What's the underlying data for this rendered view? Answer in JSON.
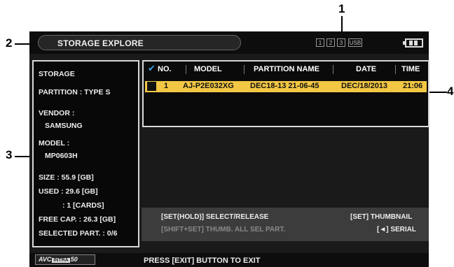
{
  "callouts": {
    "c1": "1",
    "c2": "2",
    "c3": "3",
    "c4": "4"
  },
  "header": {
    "title": "STORAGE EXPLORE",
    "slots": [
      "1",
      "2",
      "3",
      "USB"
    ],
    "battery_icon": "battery-icon"
  },
  "storage": {
    "heading": "STORAGE",
    "partition": "PARTITION : TYPE S",
    "vendor_label": "VENDOR :",
    "vendor_value": "SAMSUNG",
    "model_label": "MODEL :",
    "model_value": "MP0603H",
    "size": "SIZE : 55.9 [GB]",
    "used": "USED : 29.6 [GB]",
    "cards": ": 1 [CARDS]",
    "free": "FREE CAP. : 26.3 [GB]",
    "selected": "SELECTED PART. : 0/6"
  },
  "table": {
    "columns": [
      "NO.",
      "MODEL",
      "PARTITION NAME",
      "DATE",
      "TIME"
    ],
    "rows": [
      {
        "no": "1",
        "model": "AJ-P2E032XG",
        "partition_name": "DEC18-13 21-06-45",
        "date": "DEC/18/2013",
        "time": "21:06"
      }
    ]
  },
  "help": {
    "select": "[SET(HOLD)] SELECT/RELEASE",
    "thumbnail": "[SET] THUMBNAIL",
    "thumb_all": "[SHIFT+SET] THUMB. ALL SEL PART.",
    "serial": "[◄] SERIAL"
  },
  "footer": {
    "logo_avc": "AVC",
    "logo_intra": "INTRA",
    "logo_num": "50",
    "exit": "PRESS [EXIT] BUTTON TO EXIT"
  },
  "colors": {
    "highlight": "#f2c744",
    "check": "#3aa0e0",
    "disabled_text": "#8a8a8a"
  }
}
